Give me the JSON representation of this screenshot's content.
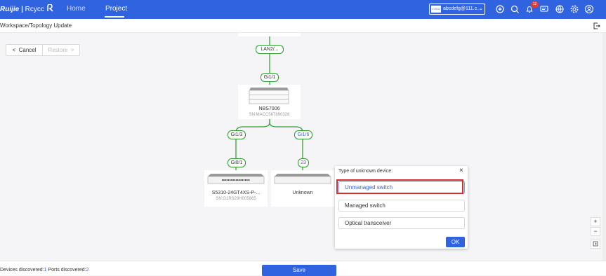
{
  "header": {
    "brand": "Ruijie",
    "brand_sub": "Rcycc",
    "nav": [
      {
        "label": "Home"
      },
      {
        "label": "Project"
      }
    ],
    "account": {
      "logo_text": "LOGO",
      "email": "abcdefg@111.c..."
    },
    "notification_count": "12"
  },
  "breadcrumb": "Workspace/Topology Update",
  "actions": {
    "cancel_label": "Cancel",
    "restore_label": "Restore"
  },
  "topology": {
    "ports": {
      "lan": "LAN2/...",
      "core_uplink": "Gi1/1",
      "core_left": "Gi1/3",
      "core_right": "Gi1/6",
      "access_left": "Gi0/1",
      "access_right": "23"
    },
    "devices": [
      {
        "name": "NBS7006",
        "sn": "SN:MACC567890328"
      },
      {
        "name": "S5310-24GT4XS-P-...",
        "sn": "SN:G1RS29H005865"
      },
      {
        "name": "Unknown",
        "sn": ""
      }
    ]
  },
  "dialog": {
    "title": "Type of unknown device:",
    "options": [
      {
        "label": "Unmanaged switch"
      },
      {
        "label": "Managed switch"
      },
      {
        "label": "Optical transceiver"
      }
    ],
    "ok_label": "OK"
  },
  "zoom": {
    "in": "+",
    "out": "−"
  },
  "footer": {
    "devices_label": "Devices discovered:",
    "devices_count": "1",
    "ports_label": "Ports discovered:",
    "ports_count": "2",
    "save_label": "Save"
  },
  "colors": {
    "primary": "#2f63e0",
    "link_green": "#2e9a2e",
    "highlight_red": "#d32f2f"
  }
}
